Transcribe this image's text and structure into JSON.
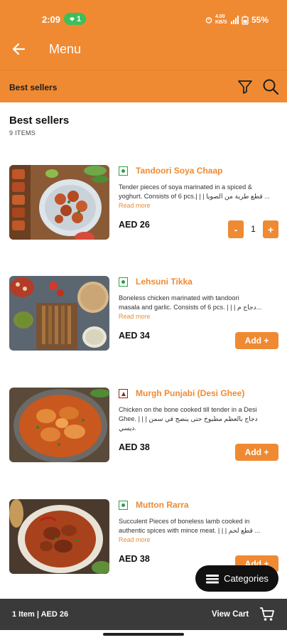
{
  "status_bar": {
    "time": "2:09",
    "hotspot_count": "1",
    "net_speed": "4.00 KB/S",
    "battery": "55%"
  },
  "app_bar": {
    "title": "Menu",
    "back_icon": "arrow-left-icon"
  },
  "sub_bar": {
    "title": "Best sellers",
    "filter_icon": "filter-icon",
    "search_icon": "search-icon"
  },
  "section": {
    "title": "Best sellers",
    "count": "9 ITEMS"
  },
  "items": [
    {
      "name": "Tandoori Soya Chaap",
      "type": "veg",
      "desc_line1": "Tender pieces of soya marinated in a spiced &",
      "desc_line2": "yoghurt. Consists of 6 pcs.| | | قطع طرية من الصويا ...",
      "read_more": "Read more",
      "price": "AED 26",
      "qty": "1",
      "minus": "-",
      "plus": "+"
    },
    {
      "name": "Lehsuni Tikka",
      "type": "veg",
      "desc_line1": "Boneless chicken marinated with tandoori",
      "desc_line2": "masala and garlic. Consists of 6 pcs. | | | دجاج م...",
      "read_more": "Read more",
      "price": "AED 34",
      "add_label": "Add +"
    },
    {
      "name": "Murgh Punjabi (Desi Ghee)",
      "type": "non-veg",
      "desc_line1": "Chicken on the bone cooked till tender in a Desi",
      "desc_line2": "Ghee. | | | دجاج بالعظم مطبوخ حتى ينضج في سمن ديسي.",
      "read_more": "",
      "price": "AED 38",
      "add_label": "Add +"
    },
    {
      "name": "Mutton Rarra",
      "type": "veg",
      "desc_line1": "Succulent Pieces of boneless lamb cooked in",
      "desc_line2": "authentic spices  with mince meat. | | | قطع لحم ...",
      "read_more": "Read more",
      "price": "AED 38",
      "add_label": "Add +"
    }
  ],
  "categories_button": {
    "label": "Categories",
    "icon": "menu-book-icon"
  },
  "cart_bar": {
    "summary": "1 Item  |  AED 26",
    "view_cart": "View Cart",
    "cart_icon": "cart-icon"
  },
  "colors": {
    "accent": "#ef8a33",
    "cart_bar": "#3a3a3a",
    "veg": "#2e9e4a",
    "non_veg": "#8b2c19"
  }
}
